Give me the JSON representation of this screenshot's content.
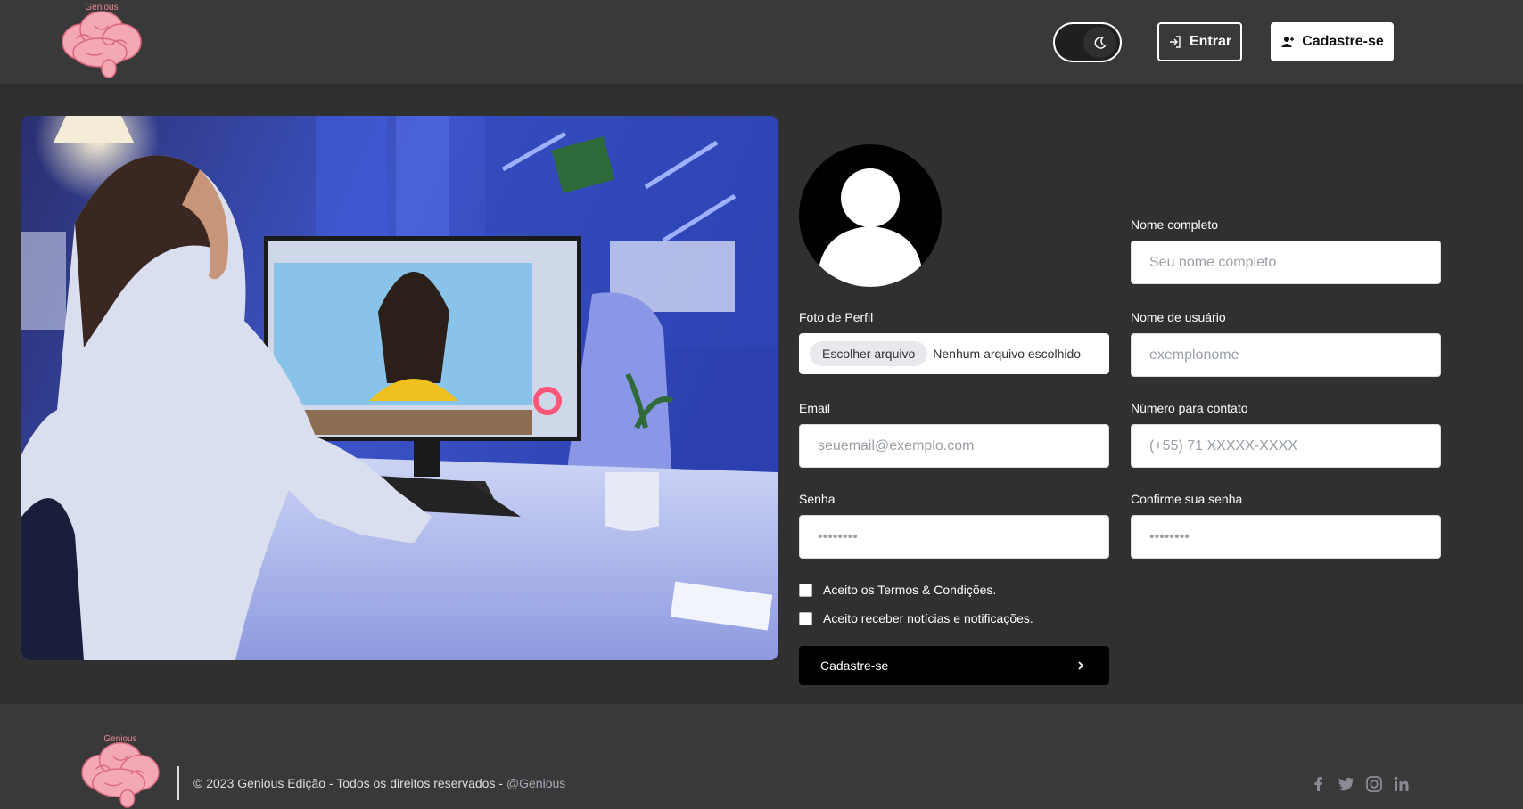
{
  "header": {
    "logo_text": "Genious",
    "theme_toggle_icon": "moon-icon",
    "login_label": "Entrar",
    "signup_label": "Cadastre-se"
  },
  "form": {
    "profile_photo_label": "Foto de Perfil",
    "file_button_label": "Escolher arquivo",
    "file_status": "Nenhum arquivo escolhido",
    "fullname_label": "Nome completo",
    "fullname_placeholder": "Seu nome completo",
    "username_label": "Nome de usuário",
    "username_placeholder": "exemplonome",
    "email_label": "Email",
    "email_placeholder": "seuemail@exemplo.com",
    "phone_label": "Número para contato",
    "phone_placeholder": "(+55) 71 XXXXX-XXXX",
    "password_label": "Senha",
    "password_placeholder": "••••••••",
    "confirm_label": "Confirme sua senha",
    "confirm_placeholder": "••••••••",
    "terms_label": "Aceito os Termos & Condições.",
    "news_label": "Aceito receber notícias e notificações.",
    "submit_label": "Cadastre-se"
  },
  "footer": {
    "logo_text": "Genious",
    "copyright": "© 2023 Genious Edição - Todos os direitos reservados - ",
    "handle": "@Genious",
    "social_icons": [
      "facebook-icon",
      "twitter-icon",
      "instagram-icon",
      "linkedin-icon"
    ]
  },
  "colors": {
    "page_bg": "#303030",
    "header_bg": "#393939",
    "brand_pink": "#f0889a"
  }
}
